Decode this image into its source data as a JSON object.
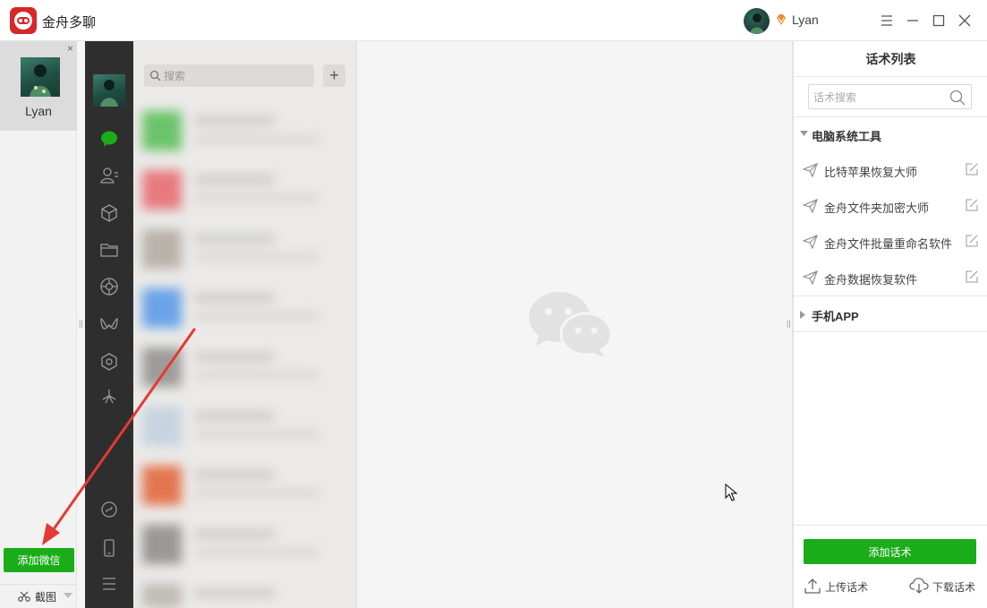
{
  "app": {
    "title": "金舟多聊",
    "brand_color": "#d5282b"
  },
  "topbar": {
    "username": "Lyan"
  },
  "account": {
    "name": "Lyan",
    "close_symbol": "×"
  },
  "actions": {
    "add_wechat": "添加微信",
    "screenshot": "截图",
    "accent_color": "#1aad19"
  },
  "chat_list": {
    "search_placeholder": "搜索",
    "add_symbol": "+"
  },
  "script_panel": {
    "title": "话术列表",
    "search_placeholder": "话术搜索",
    "groups": [
      {
        "name": "电脑系统工具",
        "expanded": true,
        "items": [
          "比特苹果恢复大师",
          "金舟文件夹加密大师",
          "金舟文件批量重命名软件",
          "金舟数据恢复软件"
        ]
      },
      {
        "name": "手机APP",
        "expanded": false,
        "items": []
      }
    ],
    "add_script": "添加话术",
    "upload": "上传话术",
    "download": "下载话术"
  }
}
